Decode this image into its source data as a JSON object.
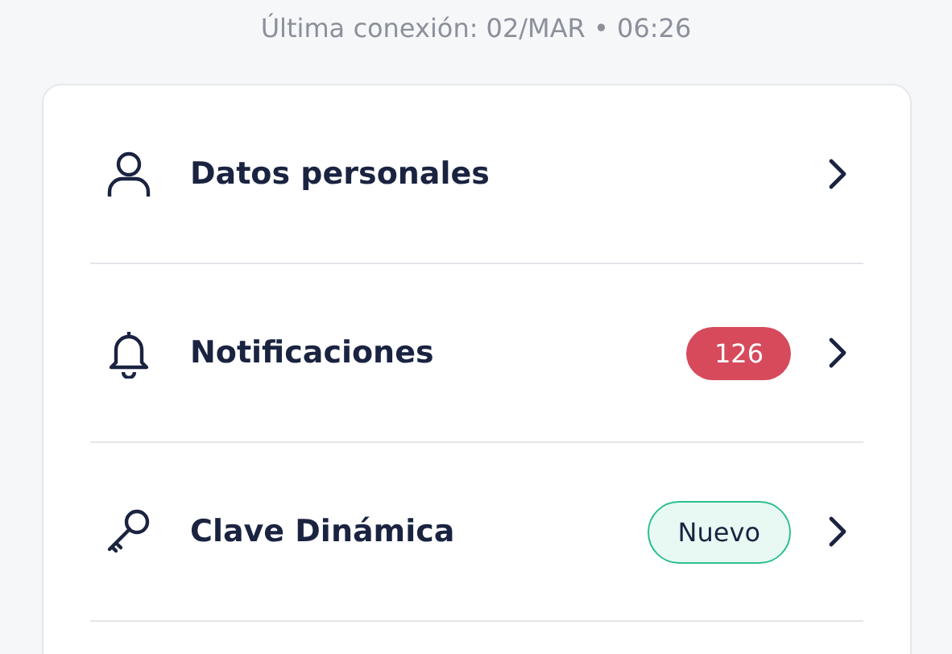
{
  "last_connection": "Última conexión: 02/MAR • 06:26",
  "menu_items": [
    {
      "label": "Datos personales"
    },
    {
      "label": "Notificaciones",
      "badge": {
        "kind": "count",
        "text": "126"
      }
    },
    {
      "label": "Clave Dinámica",
      "badge": {
        "kind": "tag",
        "text": "Nuevo"
      }
    }
  ]
}
